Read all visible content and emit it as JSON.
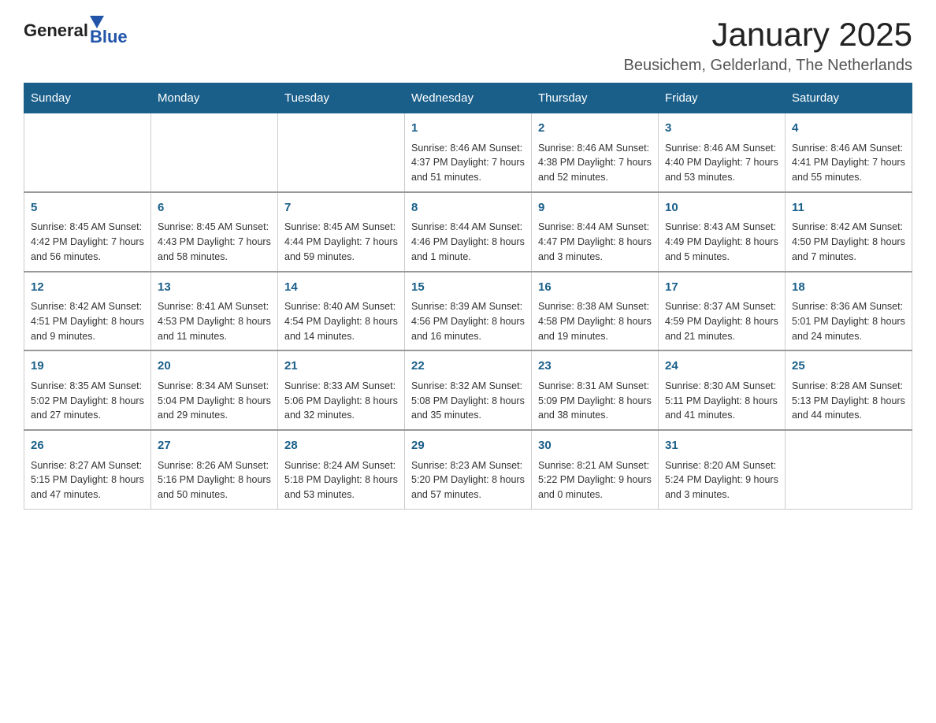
{
  "header": {
    "logo_general": "General",
    "logo_blue": "Blue",
    "month_title": "January 2025",
    "location": "Beusichem, Gelderland, The Netherlands"
  },
  "days_of_week": [
    "Sunday",
    "Monday",
    "Tuesday",
    "Wednesday",
    "Thursday",
    "Friday",
    "Saturday"
  ],
  "weeks": [
    [
      {
        "day": "",
        "info": ""
      },
      {
        "day": "",
        "info": ""
      },
      {
        "day": "",
        "info": ""
      },
      {
        "day": "1",
        "info": "Sunrise: 8:46 AM\nSunset: 4:37 PM\nDaylight: 7 hours\nand 51 minutes."
      },
      {
        "day": "2",
        "info": "Sunrise: 8:46 AM\nSunset: 4:38 PM\nDaylight: 7 hours\nand 52 minutes."
      },
      {
        "day": "3",
        "info": "Sunrise: 8:46 AM\nSunset: 4:40 PM\nDaylight: 7 hours\nand 53 minutes."
      },
      {
        "day": "4",
        "info": "Sunrise: 8:46 AM\nSunset: 4:41 PM\nDaylight: 7 hours\nand 55 minutes."
      }
    ],
    [
      {
        "day": "5",
        "info": "Sunrise: 8:45 AM\nSunset: 4:42 PM\nDaylight: 7 hours\nand 56 minutes."
      },
      {
        "day": "6",
        "info": "Sunrise: 8:45 AM\nSunset: 4:43 PM\nDaylight: 7 hours\nand 58 minutes."
      },
      {
        "day": "7",
        "info": "Sunrise: 8:45 AM\nSunset: 4:44 PM\nDaylight: 7 hours\nand 59 minutes."
      },
      {
        "day": "8",
        "info": "Sunrise: 8:44 AM\nSunset: 4:46 PM\nDaylight: 8 hours\nand 1 minute."
      },
      {
        "day": "9",
        "info": "Sunrise: 8:44 AM\nSunset: 4:47 PM\nDaylight: 8 hours\nand 3 minutes."
      },
      {
        "day": "10",
        "info": "Sunrise: 8:43 AM\nSunset: 4:49 PM\nDaylight: 8 hours\nand 5 minutes."
      },
      {
        "day": "11",
        "info": "Sunrise: 8:42 AM\nSunset: 4:50 PM\nDaylight: 8 hours\nand 7 minutes."
      }
    ],
    [
      {
        "day": "12",
        "info": "Sunrise: 8:42 AM\nSunset: 4:51 PM\nDaylight: 8 hours\nand 9 minutes."
      },
      {
        "day": "13",
        "info": "Sunrise: 8:41 AM\nSunset: 4:53 PM\nDaylight: 8 hours\nand 11 minutes."
      },
      {
        "day": "14",
        "info": "Sunrise: 8:40 AM\nSunset: 4:54 PM\nDaylight: 8 hours\nand 14 minutes."
      },
      {
        "day": "15",
        "info": "Sunrise: 8:39 AM\nSunset: 4:56 PM\nDaylight: 8 hours\nand 16 minutes."
      },
      {
        "day": "16",
        "info": "Sunrise: 8:38 AM\nSunset: 4:58 PM\nDaylight: 8 hours\nand 19 minutes."
      },
      {
        "day": "17",
        "info": "Sunrise: 8:37 AM\nSunset: 4:59 PM\nDaylight: 8 hours\nand 21 minutes."
      },
      {
        "day": "18",
        "info": "Sunrise: 8:36 AM\nSunset: 5:01 PM\nDaylight: 8 hours\nand 24 minutes."
      }
    ],
    [
      {
        "day": "19",
        "info": "Sunrise: 8:35 AM\nSunset: 5:02 PM\nDaylight: 8 hours\nand 27 minutes."
      },
      {
        "day": "20",
        "info": "Sunrise: 8:34 AM\nSunset: 5:04 PM\nDaylight: 8 hours\nand 29 minutes."
      },
      {
        "day": "21",
        "info": "Sunrise: 8:33 AM\nSunset: 5:06 PM\nDaylight: 8 hours\nand 32 minutes."
      },
      {
        "day": "22",
        "info": "Sunrise: 8:32 AM\nSunset: 5:08 PM\nDaylight: 8 hours\nand 35 minutes."
      },
      {
        "day": "23",
        "info": "Sunrise: 8:31 AM\nSunset: 5:09 PM\nDaylight: 8 hours\nand 38 minutes."
      },
      {
        "day": "24",
        "info": "Sunrise: 8:30 AM\nSunset: 5:11 PM\nDaylight: 8 hours\nand 41 minutes."
      },
      {
        "day": "25",
        "info": "Sunrise: 8:28 AM\nSunset: 5:13 PM\nDaylight: 8 hours\nand 44 minutes."
      }
    ],
    [
      {
        "day": "26",
        "info": "Sunrise: 8:27 AM\nSunset: 5:15 PM\nDaylight: 8 hours\nand 47 minutes."
      },
      {
        "day": "27",
        "info": "Sunrise: 8:26 AM\nSunset: 5:16 PM\nDaylight: 8 hours\nand 50 minutes."
      },
      {
        "day": "28",
        "info": "Sunrise: 8:24 AM\nSunset: 5:18 PM\nDaylight: 8 hours\nand 53 minutes."
      },
      {
        "day": "29",
        "info": "Sunrise: 8:23 AM\nSunset: 5:20 PM\nDaylight: 8 hours\nand 57 minutes."
      },
      {
        "day": "30",
        "info": "Sunrise: 8:21 AM\nSunset: 5:22 PM\nDaylight: 9 hours\nand 0 minutes."
      },
      {
        "day": "31",
        "info": "Sunrise: 8:20 AM\nSunset: 5:24 PM\nDaylight: 9 hours\nand 3 minutes."
      },
      {
        "day": "",
        "info": ""
      }
    ]
  ]
}
